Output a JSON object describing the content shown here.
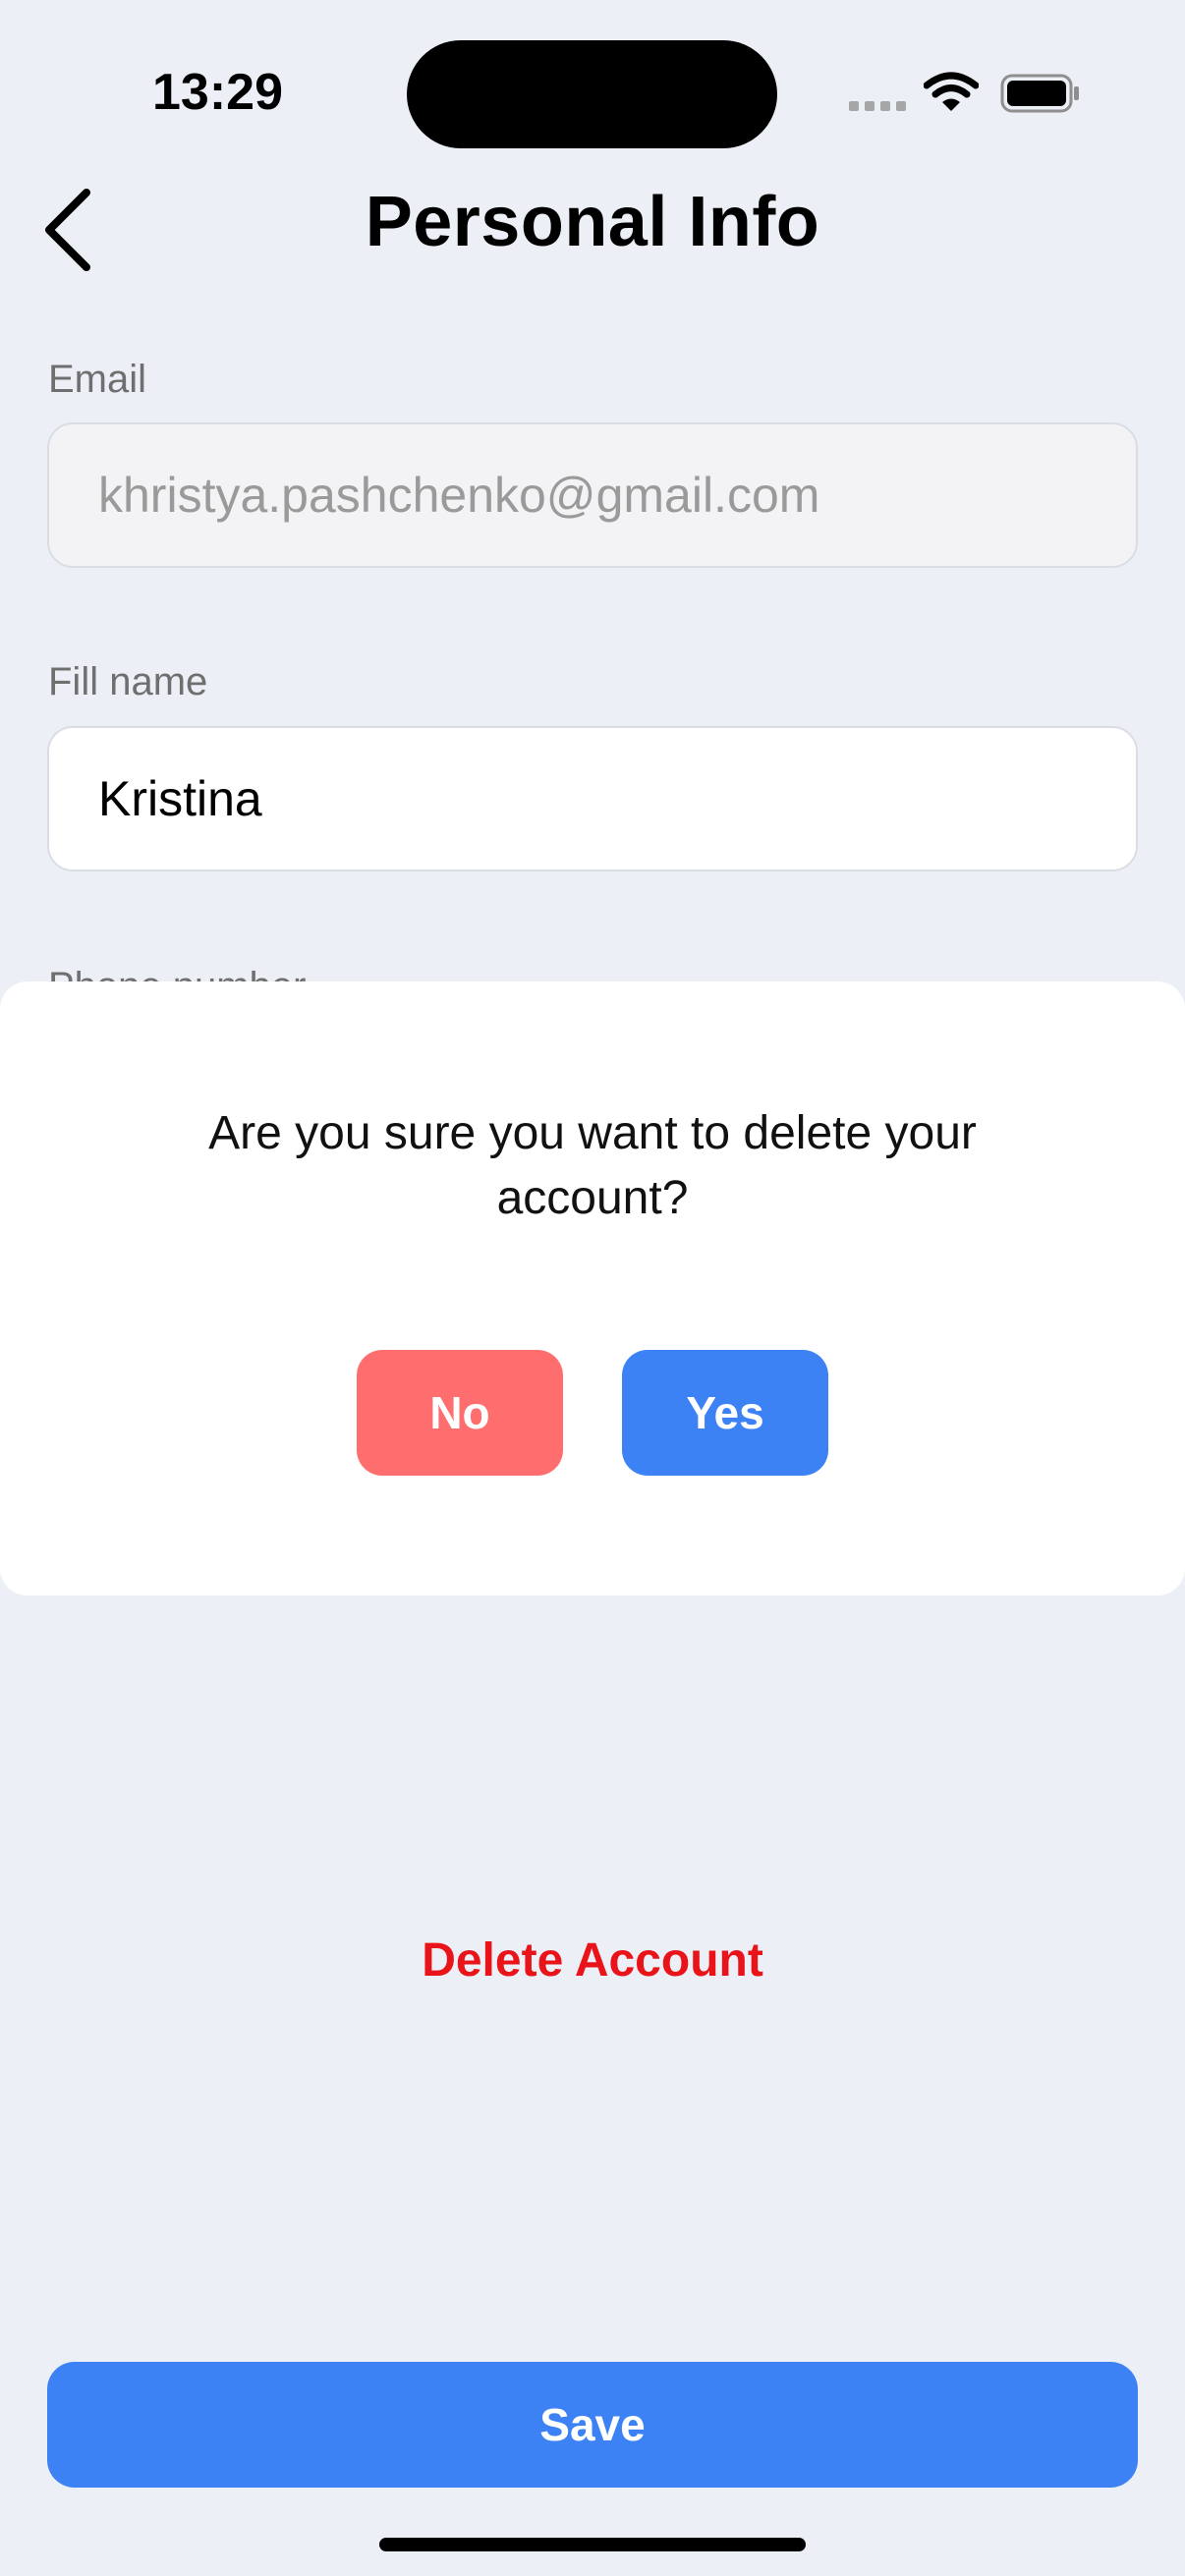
{
  "status_bar": {
    "time": "13:29"
  },
  "header": {
    "title": "Personal Info",
    "back_icon": "chevron-left-icon"
  },
  "form": {
    "email": {
      "label": "Email",
      "value": "khristya.pashchenko@gmail.com"
    },
    "name": {
      "label": "Fill name",
      "value": "Kristina"
    },
    "phone": {
      "label": "Phone number"
    }
  },
  "modal": {
    "question": "Are you sure you want to delete your account?",
    "no_label": "No",
    "yes_label": "Yes"
  },
  "actions": {
    "delete_label": "Delete Account",
    "save_label": "Save"
  },
  "colors": {
    "background": "#ECEFF6",
    "primary": "#3C82F5",
    "danger_button": "#FF6E6E",
    "danger_text": "#E8141A"
  }
}
